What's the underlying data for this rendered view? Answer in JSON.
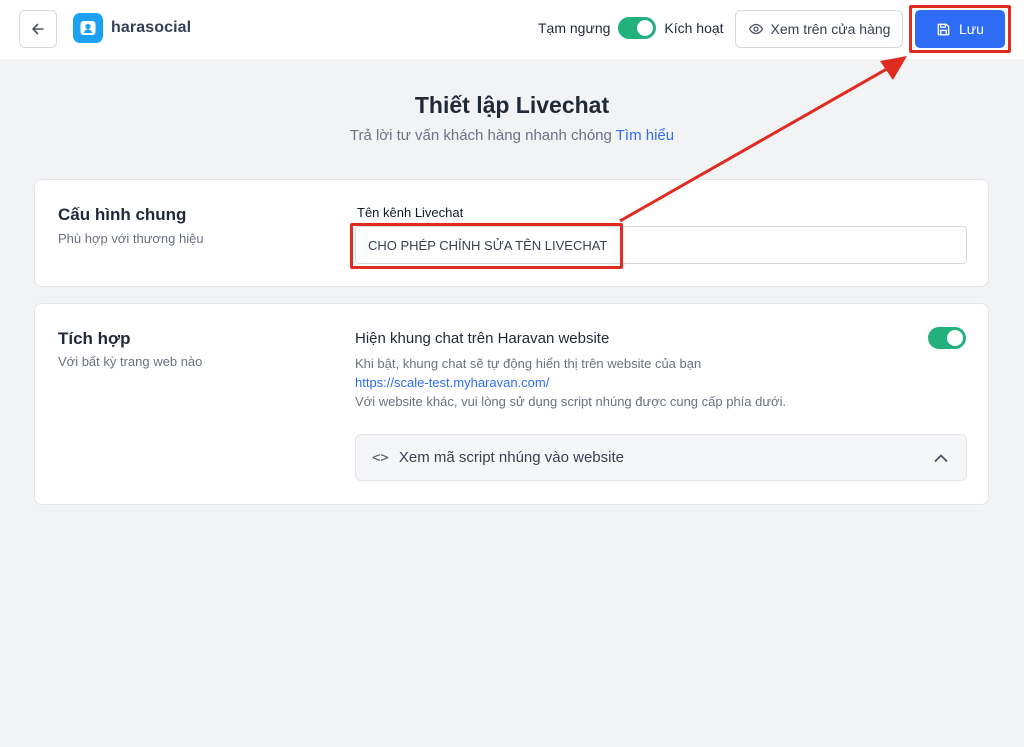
{
  "header": {
    "brand": "harasocial",
    "status_off_label": "Tạm ngưng",
    "status_on_label": "Kích hoạt",
    "view_store_label": "Xem trên cửa hàng",
    "save_label": "Lưu"
  },
  "page": {
    "title": "Thiết lập Livechat",
    "subtitle": "Trả lời tư vấn khách hàng nhanh chóng",
    "learn_more": "Tìm hiểu"
  },
  "general": {
    "title": "Cấu hình chung",
    "desc": "Phù hợp với thương hiệu",
    "field_label": "Tên kênh Livechat",
    "field_value": "CHO PHÉP CHỈNH SỬA TÊN LIVECHAT"
  },
  "integration": {
    "title": "Tích hợp",
    "desc": "Với bất kỳ trang web nào",
    "option_title": "Hiện khung chat trên Haravan website",
    "option_desc": "Khi bật, khung chat sẽ tự động hiển thị trên website của bạn",
    "website_url": "https://scale-test.myharavan.com/",
    "other_desc": "Với website khác, vui lòng sử dụng script nhúng được cung cấp phía dưới.",
    "script_label": "Xem mã script nhúng vào website"
  },
  "colors": {
    "primary": "#2f6cf6",
    "toggle_on": "#22b07d",
    "highlight": "#e02b1f"
  },
  "icons": [
    "back-arrow-icon",
    "harasocial-logo-icon",
    "eye-icon",
    "save-disk-icon",
    "code-icon",
    "chevron-up-icon"
  ]
}
